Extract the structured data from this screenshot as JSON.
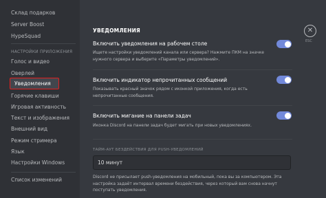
{
  "sidebar": {
    "items_top": [
      "Склад подарков",
      "Server Boost",
      "HypeSquad"
    ],
    "section_header": "НАСТРОЙКИ ПРИЛОЖЕНИЯ",
    "items_app": [
      "Голос и видео",
      "Оверлей",
      "Уведомления",
      "Горячие клавиши",
      "Игровая активность",
      "Текст и изображения",
      "Внешний вид",
      "Режим стримера",
      "Язык",
      "Настройки Windows"
    ],
    "items_bottom": [
      "Список изменений"
    ]
  },
  "main": {
    "title": "УВЕДОМЛЕНИЯ",
    "settings": [
      {
        "title": "Включить уведомления на рабочем столе",
        "description": "Ищете настройки уведомлений канала или сервера? Нажмите ПКМ на значке нужного сервера и выберите «Параметры уведомлений».",
        "enabled": true
      },
      {
        "title": "Включить индикатор непрочитанных сообщений",
        "description": "Показывать красный значок рядом с иконкой приложения, когда есть непрочитанные сообщения.",
        "enabled": true
      },
      {
        "title": "Включить мигание на панели задач",
        "description": "Иконка Discord на панели задач будет мигать при новых уведомлениях.",
        "enabled": true
      }
    ],
    "afk_header": "ТАЙМ-АУТ БЕЗДЕЙСТВИЯ ДЛЯ PUSH-УВЕДОМЛЕНИЙ",
    "afk_value": "10 минут",
    "afk_description": "Discord не присылает push-уведомления на мобильный, пока вы за компьютером. Эта настройка задаёт интервал времени бездействия, через который вам снова начнут поступать уведомления."
  },
  "close": {
    "esc_label": "ESC"
  },
  "colors": {
    "accent": "#7289da",
    "highlight_border": "#e21f1f"
  }
}
